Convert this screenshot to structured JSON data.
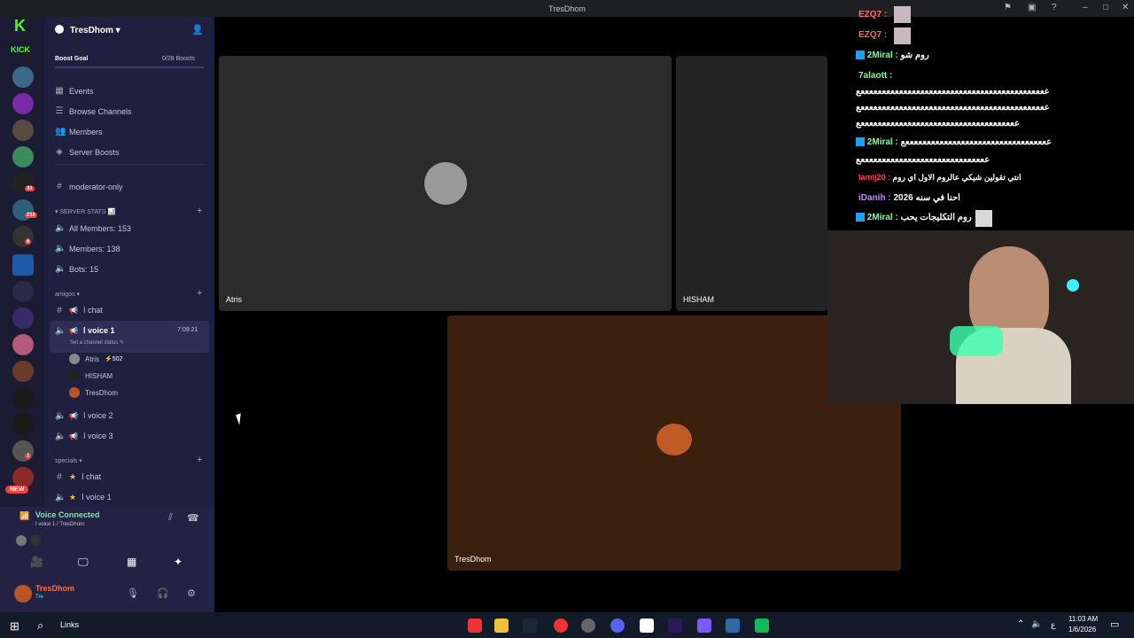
{
  "window": {
    "title": "TresDhom"
  },
  "guild_badges": [
    "31",
    "218",
    "6",
    "2",
    "NEW"
  ],
  "server": {
    "name": "TresDhom",
    "boost_goal": "Boost Goal",
    "boosts": "0/28 Boosts"
  },
  "nav": [
    "Events",
    "Browse Channels",
    "Members",
    "Server Boosts"
  ],
  "channels": {
    "moderator": "moderator-only",
    "stats_category": "SERVER STATS 📊",
    "stats": [
      "All Members: 153",
      "Members: 138",
      "Bots: 15"
    ],
    "amigos_category": "amigos",
    "amigos": [
      "ا chat",
      "ا voice 1",
      "ا voice 2",
      "ا voice 3"
    ],
    "voice1_time": "7:09:21",
    "voice1_status": "Set a channel status",
    "voice_members": [
      "Atris",
      "HISHAM",
      "TresDhom"
    ],
    "atris_extra": "502",
    "specials_category": "specials",
    "specials": [
      "ا chat",
      "ا voice 1"
    ]
  },
  "voice_panel": {
    "status": "Voice Connected",
    "location": "ا voice 1 / TresDhom"
  },
  "user": {
    "name": "TresDhom",
    "sub": "Tre"
  },
  "tiles": [
    "Atris",
    "HISHAM",
    "TresDhom"
  ],
  "chat": [
    {
      "user": "EZQ7 :",
      "text": "",
      "color": "#ff6b6b"
    },
    {
      "user": "EZQ7 :",
      "text": "",
      "color": "#ff6b6b"
    },
    {
      "user": "2Miral :",
      "text": "روم شو",
      "color": "#7dff9c"
    },
    {
      "user": "7alaott :",
      "text": "",
      "color": "#7dff9c"
    },
    {
      "user": "",
      "text": "ععععععععععععععععععععععععععععععععععععععععععععع",
      "color": "#fff"
    },
    {
      "user": "",
      "text": "ععععععععععععععععععععععععععععععععععععععععععععع",
      "color": "#fff"
    },
    {
      "user": "",
      "text": "عععععععععععععععععععععععععععععععععععععع",
      "color": "#fff"
    },
    {
      "user": "2Miral :",
      "text": "ععععععععععععععععععععععععععععععععععع",
      "color": "#7dff9c"
    },
    {
      "user": "",
      "text": "ععععععععععععععععععععععععععععععع",
      "color": "#fff"
    },
    {
      "user": "lamlj20 :",
      "text": "انتي تقولين شيكي عالروم الاول اي روم",
      "color": "#ff4444"
    },
    {
      "user": "iDanih :",
      "text": "احنا في سنه 2026",
      "color": "#c58bff"
    },
    {
      "user": "2Miral :",
      "text": "روم التكليجات يحب",
      "color": "#7dff9c"
    }
  ],
  "taskbar": {
    "search": "Links",
    "time": "11:03 AM",
    "date": "1/6/2026",
    "lang": "ع"
  }
}
